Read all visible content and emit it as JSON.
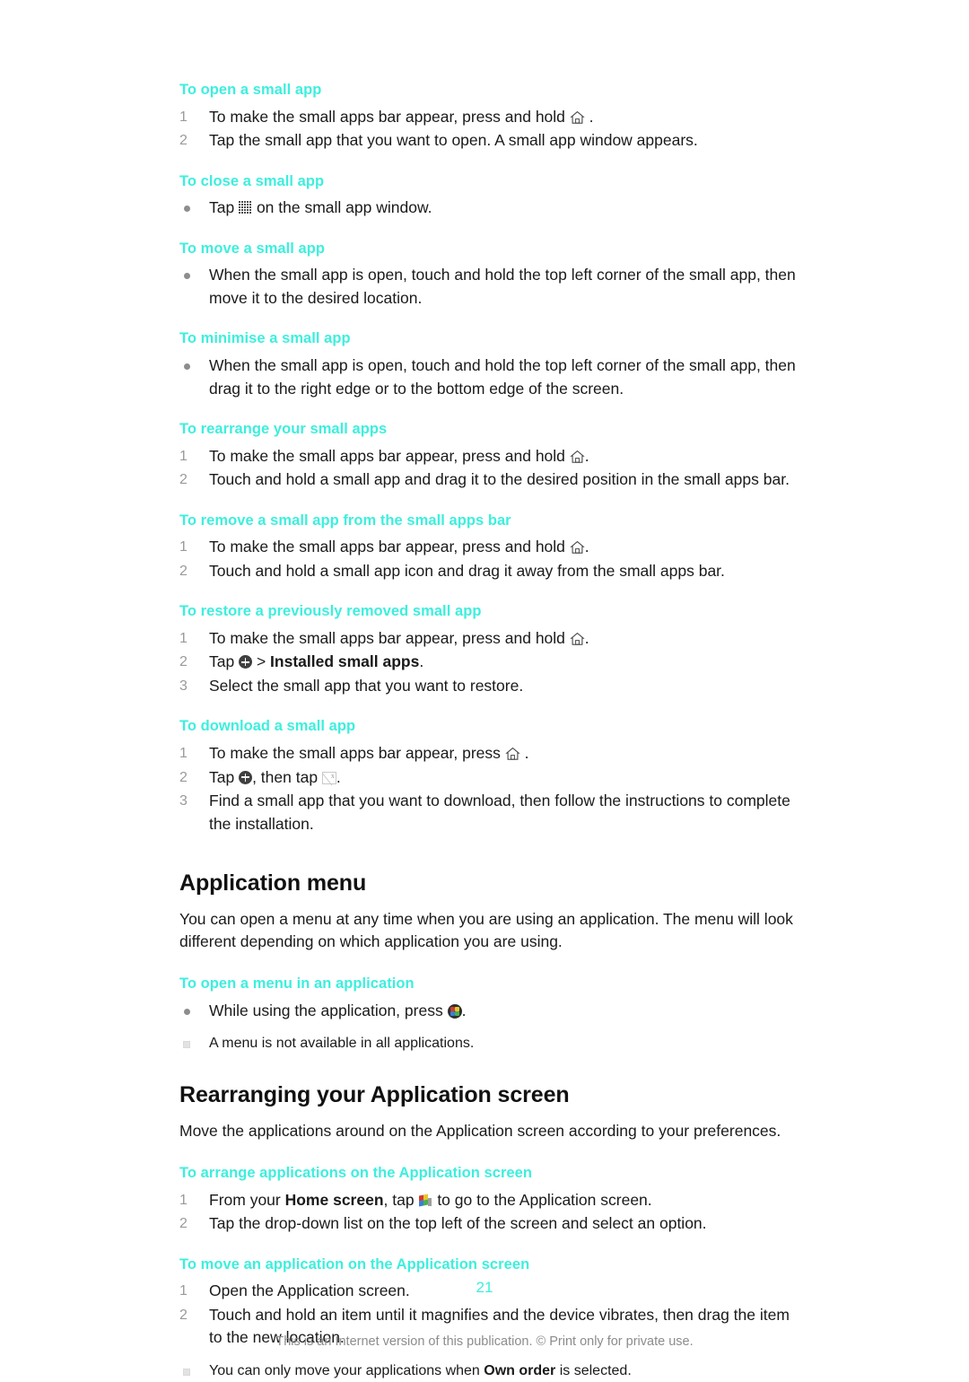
{
  "document": {
    "page_number": "21",
    "footer_note": "This is an Internet version of this publication. © Print only for private use.",
    "heading_color": "#3defdd"
  },
  "sections": {
    "open_small_app": {
      "heading": "To open a small app",
      "steps": [
        {
          "num": "1",
          "before": "To make the small apps bar appear, press and hold ",
          "icon": "home-icon",
          "after": " ."
        },
        {
          "num": "2",
          "before": "Tap the small app that you want to open. A small app window appears.",
          "icon": "",
          "after": ""
        }
      ]
    },
    "close_small_app": {
      "heading": "To close a small app",
      "bullets": [
        {
          "before": "Tap ",
          "icon": "grid-icon",
          "after": " on the small app window."
        }
      ]
    },
    "move_small_app": {
      "heading": "To move a small app",
      "bullets": [
        {
          "before": "When the small app is open, touch and hold the top left corner of the small app, then move it to the desired location.",
          "icon": "",
          "after": ""
        }
      ]
    },
    "minimise_small_app": {
      "heading": "To minimise a small app",
      "bullets": [
        {
          "before": "When the small app is open, touch and hold the top left corner of the small app, then drag it to the right edge or to the bottom edge of the screen.",
          "icon": "",
          "after": ""
        }
      ]
    },
    "rearrange_small_apps": {
      "heading": "To rearrange your small apps",
      "steps": [
        {
          "num": "1",
          "before": "To make the small apps bar appear, press and hold ",
          "icon": "home-icon",
          "after": "."
        },
        {
          "num": "2",
          "before": "Touch and hold a small app and drag it to the desired position in the small apps bar.",
          "icon": "",
          "after": ""
        }
      ]
    },
    "remove_small_app": {
      "heading": "To remove a small app from the small apps bar",
      "steps": [
        {
          "num": "1",
          "before": "To make the small apps bar appear, press and hold ",
          "icon": "home-icon",
          "after": "."
        },
        {
          "num": "2",
          "before": "Touch and hold a small app icon and drag it away from the small apps bar.",
          "icon": "",
          "after": ""
        }
      ]
    },
    "restore_small_app": {
      "heading": "To restore a previously removed small app",
      "steps": [
        {
          "num": "1",
          "before": "To make the small apps bar appear, press and hold ",
          "icon": "home-icon",
          "after": "."
        },
        {
          "num": "2",
          "before": "Tap ",
          "icon": "plus-circle-icon",
          "after": " > ",
          "bold": "Installed small apps",
          "tail": "."
        },
        {
          "num": "3",
          "before": "Select the small app that you want to restore.",
          "icon": "",
          "after": ""
        }
      ]
    },
    "download_small_app": {
      "heading": "To download a small app",
      "steps": [
        {
          "num": "1",
          "before": "To make the small apps bar appear, press ",
          "icon": "home-icon",
          "after": " ."
        },
        {
          "num": "2",
          "before": "Tap ",
          "icon": "plus-circle-icon",
          "after": ", then tap ",
          "icon2": "broken-image-icon",
          "tail": "."
        },
        {
          "num": "3",
          "before": "Find a small app that you want to download, then follow the instructions to complete the installation.",
          "icon": "",
          "after": ""
        }
      ]
    },
    "application_menu": {
      "heading": "Application menu",
      "paragraph": "You can open a menu at any time when you are using an application. The menu will look different depending on which application you are using.",
      "open_menu": {
        "heading": "To open a menu in an application",
        "bullets": [
          {
            "before": "While using the application, press ",
            "icon": "app-menu-icon",
            "after": "."
          }
        ],
        "note": "A menu is not available in all applications."
      }
    },
    "rearranging_application_screen": {
      "heading": "Rearranging your Application screen",
      "paragraph": "Move the applications around on the Application screen according to your preferences.",
      "arrange_apps": {
        "heading": "To arrange applications on the Application screen",
        "steps": [
          {
            "num": "1",
            "before": "From your ",
            "bold": "Home screen",
            "mid": ", tap ",
            "icon": "app-drawer-icon",
            "after": " to go to the Application screen."
          },
          {
            "num": "2",
            "before": "Tap the drop-down list on the top left of the screen and select an option.",
            "icon": "",
            "after": ""
          }
        ]
      },
      "move_app": {
        "heading": "To move an application on the Application screen",
        "steps": [
          {
            "num": "1",
            "before": "Open the Application screen.",
            "icon": "",
            "after": ""
          },
          {
            "num": "2",
            "before": "Touch and hold an item until it magnifies and the device vibrates, then drag the item to the new location.",
            "icon": "",
            "after": ""
          }
        ],
        "note_before": "You can only move your applications when ",
        "note_bold": "Own order",
        "note_after": " is selected."
      }
    }
  }
}
